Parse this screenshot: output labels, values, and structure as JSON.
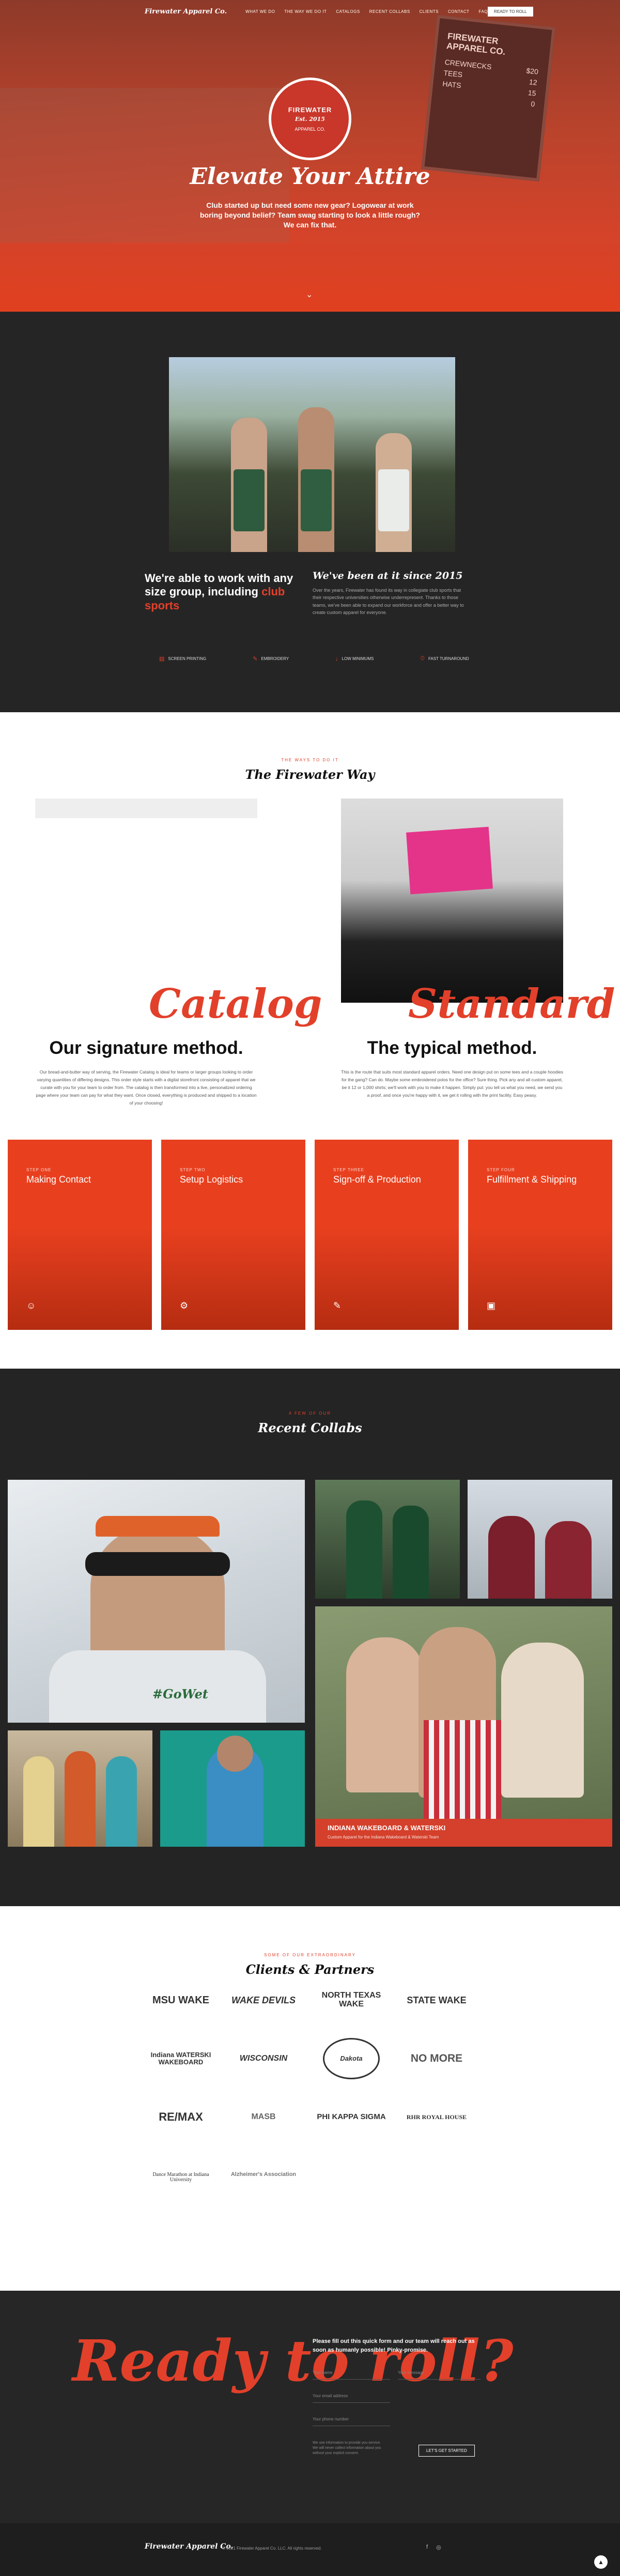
{
  "nav": {
    "brand": "Firewater Apparel Co.",
    "links": [
      "What We Do",
      "The Way We Do It",
      "Catalogs",
      "Recent Collabs",
      "Clients",
      "Contact",
      "FAQ"
    ],
    "cta": "Ready to Roll"
  },
  "hero": {
    "sign_title": "FIREWATER APPAREL CO.",
    "sign_rows": [
      [
        "CREWNECKS",
        "$20"
      ],
      [
        "TEES",
        "12"
      ],
      [
        "HATS",
        "15"
      ],
      [
        "",
        "0"
      ]
    ],
    "badge_top": "FIREWATER",
    "badge_mid": "Est. 2015",
    "badge_bottom": "APPAREL CO.",
    "title": "Elevate Your Attire",
    "subtitle": "Club started up but need some new gear? Logowear at work boring beyond belief? Team swag starting to look a little rough? We can fix that."
  },
  "about": {
    "headline_prefix": "We're able to work with any size group, including",
    "headline_accent": "club sports",
    "script_title": "We've been at it since 2015",
    "paragraph": "Over the years, Firewater has found its way in collegiate club sports that their respective universities otherwise underrepresent. Thanks to those teams, we've been able to expand our workforce and offer a better way to create custom apparel for everyone.",
    "features": [
      {
        "icon": "screen-printing-icon",
        "glyph": "▤",
        "label": "Screen Printing"
      },
      {
        "icon": "embroidery-icon",
        "glyph": "✎",
        "label": "Embroidery"
      },
      {
        "icon": "low-minimums-icon",
        "glyph": "↓",
        "label": "Low Minimums"
      },
      {
        "icon": "fast-turnaround-icon",
        "glyph": "⏱",
        "label": "Fast Turnaround"
      }
    ]
  },
  "way": {
    "eyebrow": "THE WAYS TO DO IT",
    "title": "The Firewater Way",
    "catalog_script": "Catalog",
    "catalog_title": "Our signature method.",
    "catalog_text": "Our bread-and-butter way of serving, the Firewater Catalog is ideal for teams or larger groups looking to order varying quantities of differing designs. This order style starts with a digital storefront consisting of apparel that we curate with you for your team to order from. The catalog is then transformed into a live, personalized ordering page where your team can pay for what they want. Once closed, everything is produced and shipped to a location of your choosing!",
    "standard_script": "Standard",
    "standard_title": "The typical method.",
    "standard_text": "This is the route that suits most standard apparel orders. Need one design put on some tees and a couple hoodies for the gang? Can do. Maybe some embroidered polos for the office? Sure thing. Pick any and all custom apparel, be it 12 or 1,000 shirts; we'll work with you to make it happen. Simply put: you tell us what you need, we send you a proof, and once you're happy with it, we get it rolling with the print facility. Easy peasy.",
    "steps": [
      {
        "num": "Step One",
        "label": "Making Contact",
        "icon": "handshake-icon",
        "glyph": "☺"
      },
      {
        "num": "Step Two",
        "label": "Setup Logistics",
        "icon": "gears-icon",
        "glyph": "⚙"
      },
      {
        "num": "Step Three",
        "label": "Sign-off & Production",
        "icon": "pen-icon",
        "glyph": "✎"
      },
      {
        "num": "Step Four",
        "label": "Fulfillment & Shipping",
        "icon": "box-icon",
        "glyph": "▣"
      }
    ]
  },
  "collabs": {
    "eyebrow": "A FEW OF OUR",
    "title": "Recent Collabs",
    "caption_title": "INDIANA WAKEBOARD & WATERSKI",
    "caption_sub": "Custom Apparel for the Indiana Wakeboard & Waterski Team",
    "hoodie_text": "#GoWet"
  },
  "clients": {
    "eyebrow": "SOME OF OUR EXTRAORDINARY",
    "title": "Clients & Partners",
    "logos": [
      "MSU WAKE",
      "WAKE DEVILS",
      "NORTH TEXAS WAKE",
      "STATE WAKE",
      "Indiana WATERSKI WAKEBOARD",
      "WISCONSIN",
      "Dakota",
      "NO MORE",
      "RE/MAX",
      "MASB",
      "PHI KAPPA SIGMA",
      "RHR ROYAL HOUSE",
      "Dance Marathon at Indiana University",
      "Alzheimer's Association"
    ]
  },
  "contact": {
    "headline": "Ready to roll?",
    "form_title": "Please fill out this quick form and our team will reach out as soon as humanly possible! Pinky-promise.",
    "name_ph": "Your name",
    "message_ph": "Your message",
    "email_ph": "Your email address",
    "phone_ph": "Your phone number",
    "note": "We use information to provide you service. We will never collect information about you without your explicit consent.",
    "submit": "Let's get started"
  },
  "footer": {
    "brand": "Firewater Apparel Co.",
    "copyright": "© 2021 Firewater Apparel Co. LLC. All rights reserved.",
    "facebook": "f",
    "instagram": "◎",
    "back_top": "▲"
  }
}
